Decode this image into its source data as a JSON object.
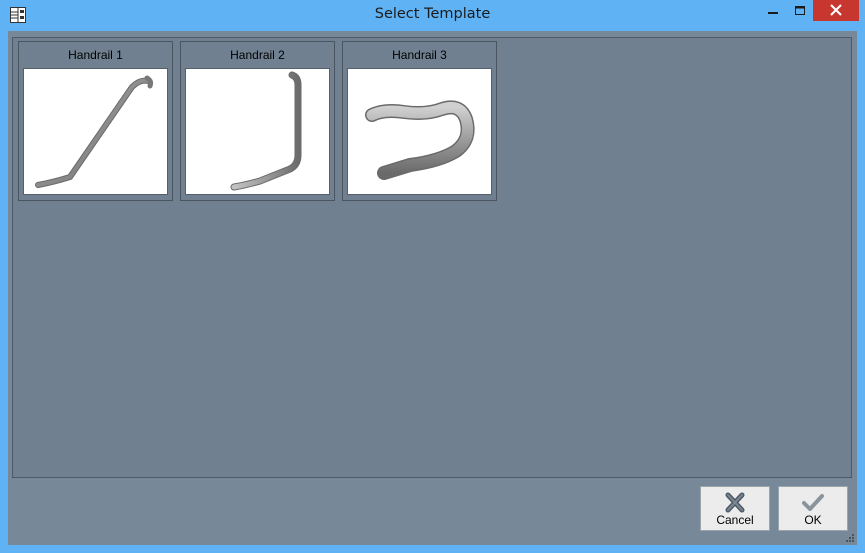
{
  "window": {
    "title": "Select Template"
  },
  "title_controls": {
    "minimize_icon": "minimize-icon",
    "maximize_icon": "maximize-icon",
    "close_icon": "close-icon"
  },
  "templates": [
    {
      "label": "Handrail 1",
      "icon": "straight-angled-handrail"
    },
    {
      "label": "Handrail 2",
      "icon": "bent-handrail"
    },
    {
      "label": "Handrail 3",
      "icon": "u-shaped-handrail"
    }
  ],
  "buttons": {
    "cancel_label": "Cancel",
    "ok_label": "OK"
  },
  "colors": {
    "titlebar": "#5fb3f5",
    "panel": "#708090",
    "close_button": "#c7372f",
    "ok_check": "#8a949c"
  }
}
